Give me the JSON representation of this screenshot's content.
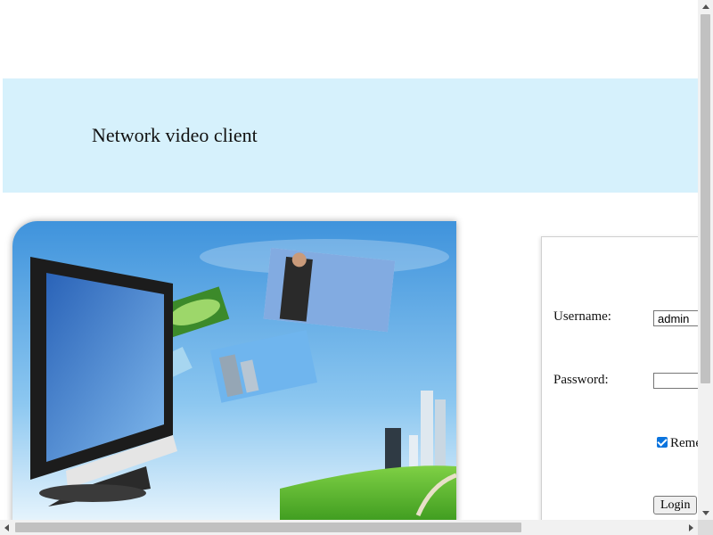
{
  "header": {
    "title": "Network video client"
  },
  "hero": {
    "icon": "monitor-with-flying-photos-illustration"
  },
  "login": {
    "username_label": "Username:",
    "username_value": "admin",
    "password_label": "Password:",
    "password_value": "",
    "remember_label": "Remember",
    "remember_checked": true,
    "login_button": "Login"
  },
  "colors": {
    "banner": "#d6f1fc",
    "checkbox": "#0b74de",
    "sky": "#5aa9e6",
    "grass": "#4caf2a"
  }
}
